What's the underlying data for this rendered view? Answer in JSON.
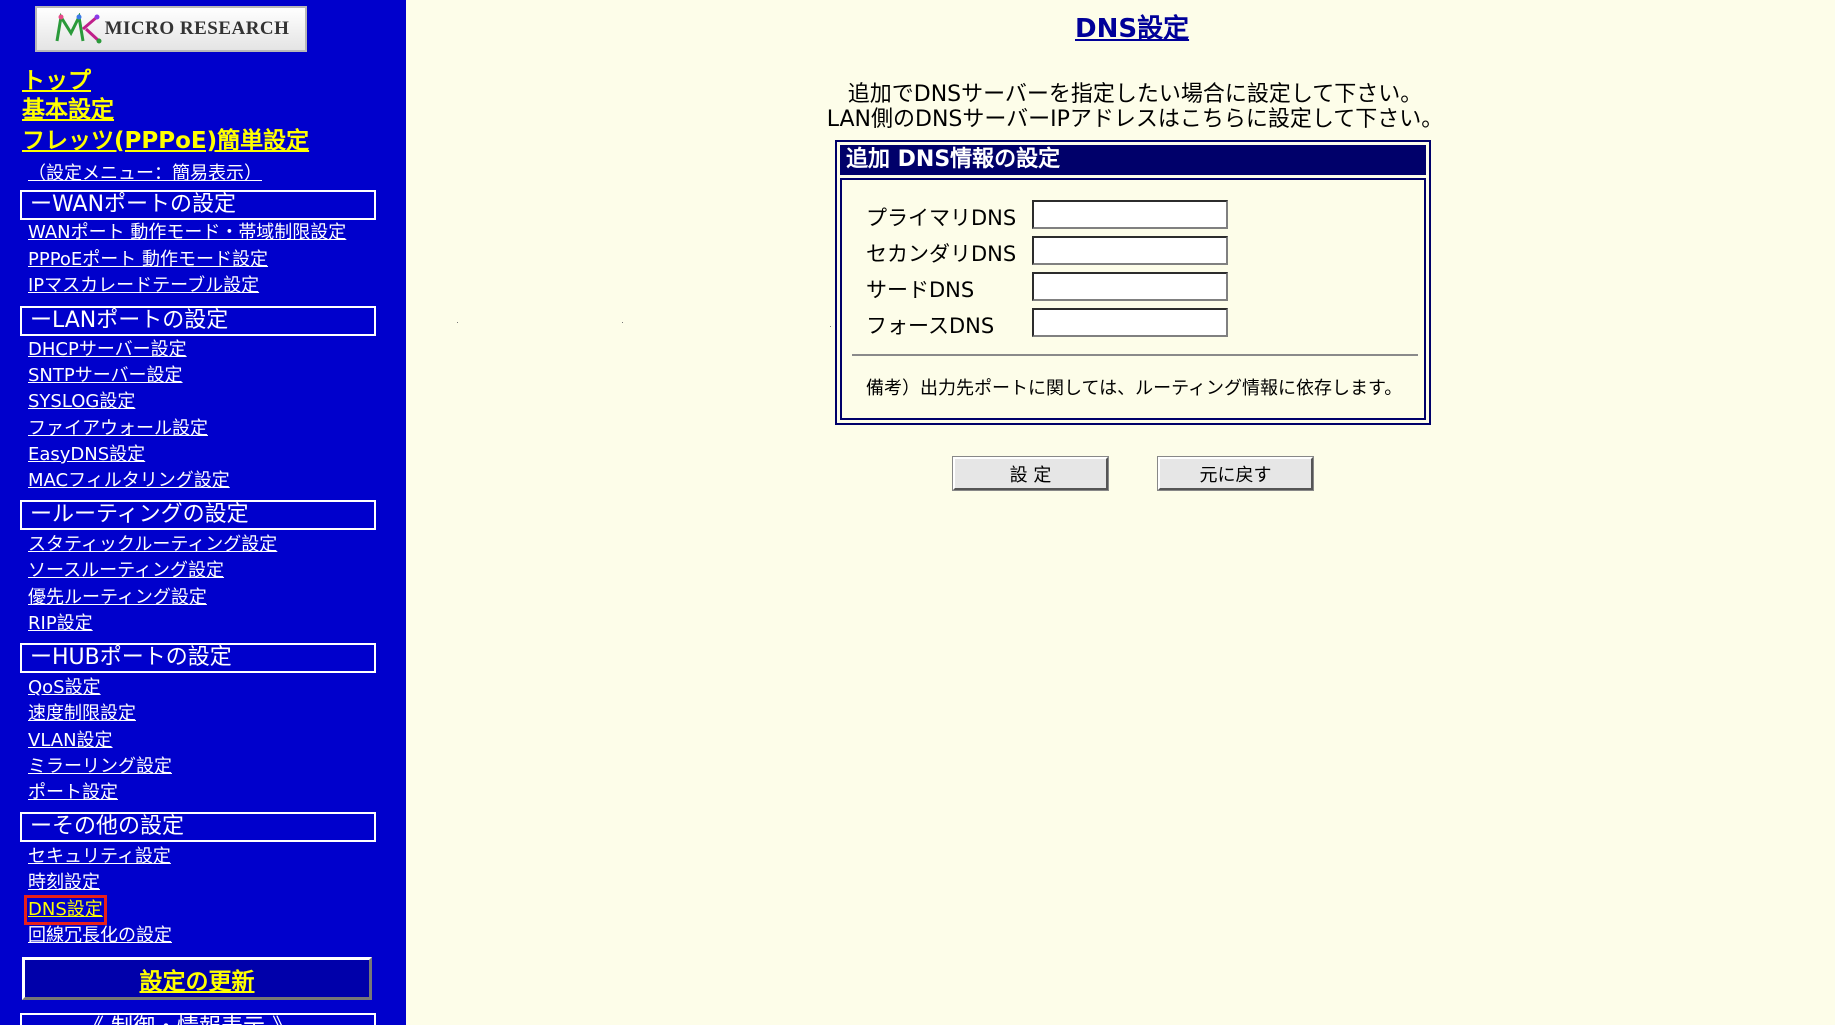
{
  "sidebar": {
    "logo_text": "MICRO RESEARCH",
    "top_links": {
      "top": "トップ",
      "basic": "基本設定",
      "flets": "フレッツ(PPPoE)簡単設定"
    },
    "menu_mode": "（設定メニュー：簡易表示）",
    "sections": {
      "wan": {
        "title": "ーWANポートの設定",
        "items": [
          "WANポート 動作モード・帯域制限設定",
          "PPPoEポート 動作モード設定",
          "IPマスカレードテーブル設定"
        ]
      },
      "lan": {
        "title": "ーLANポートの設定",
        "items": [
          "DHCPサーバー設定",
          "SNTPサーバー設定",
          "SYSLOG設定",
          "ファイアウォール設定",
          "EasyDNS設定",
          "MACフィルタリング設定"
        ]
      },
      "routing": {
        "title": "ールーティングの設定",
        "items": [
          "スタティックルーティング設定",
          "ソースルーティング設定",
          "優先ルーティング設定",
          "RIP設定"
        ]
      },
      "hub": {
        "title": "ーHUBポートの設定",
        "items": [
          "QoS設定",
          "速度制限設定",
          "VLAN設定",
          "ミラーリング設定",
          "ポート設定"
        ]
      },
      "other": {
        "title": "ーその他の設定",
        "items": [
          "セキュリティ設定",
          "時刻設定",
          "DNS設定",
          "回線冗長化の設定"
        ]
      }
    },
    "update_button": "設定の更新",
    "status_section_cut": "《 制御・情報表示 》"
  },
  "main": {
    "title": "DNS設定",
    "intro_lines": [
      "追加でDNSサーバーを指定したい場合に設定して下さい。",
      "LAN側のDNSサーバーIPアドレスはこちらに設定して下さい。"
    ],
    "panel": {
      "header": "追加 DNS情報の設定",
      "fields": [
        {
          "label": "プライマリDNS",
          "value": ""
        },
        {
          "label": "セカンダリDNS",
          "value": ""
        },
        {
          "label": "サードDNS",
          "value": ""
        },
        {
          "label": "フォースDNS",
          "value": ""
        }
      ],
      "note": "備考）出力先ポートに関しては、ルーティング情報に依存します。"
    },
    "buttons": {
      "submit": "設 定",
      "reset": "元に戻す"
    }
  },
  "colors": {
    "sidebar_bg": "#0000cc",
    "link_yellow": "#ffff00",
    "page_bg": "#fdfde9",
    "panel_navy": "#00006a",
    "active_highlight": "#e8201a"
  }
}
